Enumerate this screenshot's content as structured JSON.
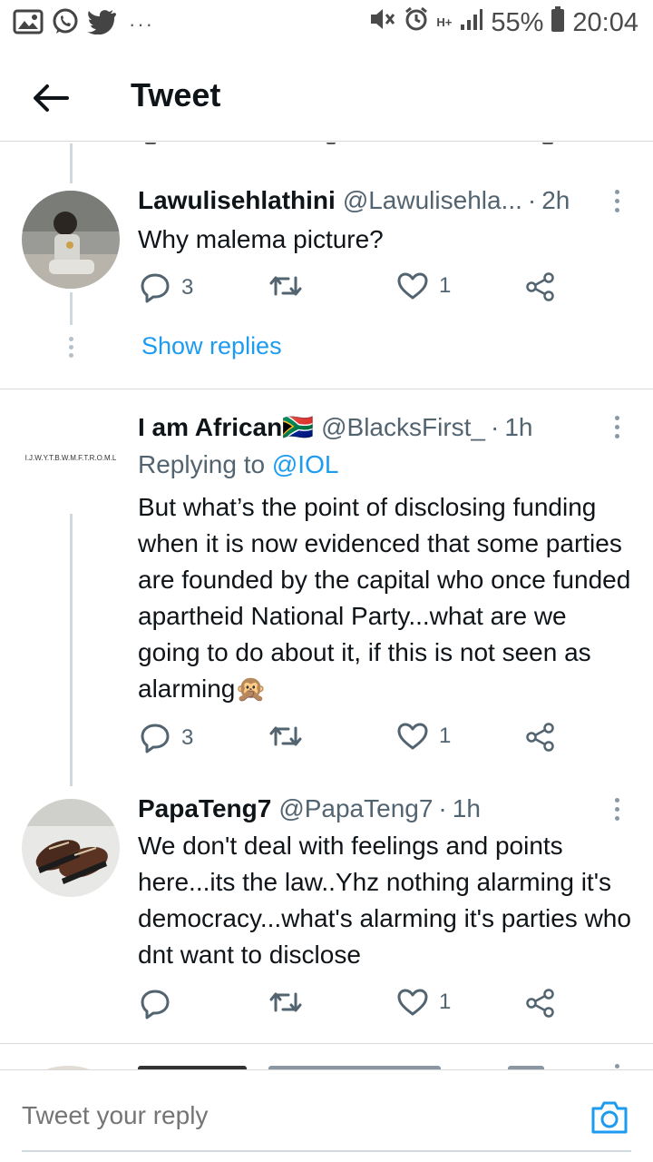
{
  "status_bar": {
    "battery": "55%",
    "time": "20:04",
    "network": "H+",
    "more_dots": "···"
  },
  "header": {
    "title": "Tweet"
  },
  "tweets": [
    {
      "name": "Lawulisehlathini",
      "handle": "@Lawulisehla...",
      "separator": "·",
      "time": "2h",
      "text": "Why malema picture?",
      "replies": "3",
      "retweets": "",
      "likes": "1"
    },
    {
      "name": "I am African🇿🇦",
      "handle": "@BlacksFirst_",
      "separator": "·",
      "time": "1h",
      "avatar_text": "I.J.W.Y.T.B.W.M.F.T.R.O.M.L",
      "replying_prefix": "Replying to",
      "replying_handle": "@IOL",
      "text": "But what’s the point of disclosing funding when it is now evidenced that some parties are founded by the capital who once funded apartheid National Party...what are we going to do about it, if this is not seen as alarming🙊",
      "replies": "3",
      "retweets": "",
      "likes": "1"
    },
    {
      "name": "PapaTeng7",
      "handle": "@PapaTeng7",
      "separator": "·",
      "time": "1h",
      "text": "We don't deal with feelings and points here...its the law..Yhz nothing alarming it's democracy...what's alarming it's parties who dnt want to disclose",
      "replies": "",
      "retweets": "",
      "likes": "1"
    }
  ],
  "show_replies_label": "Show replies",
  "reply_bar": {
    "placeholder": "Tweet your reply"
  },
  "colors": {
    "accent": "#1d9bf0",
    "secondary_text": "#536471",
    "primary_text": "#0f1419"
  }
}
